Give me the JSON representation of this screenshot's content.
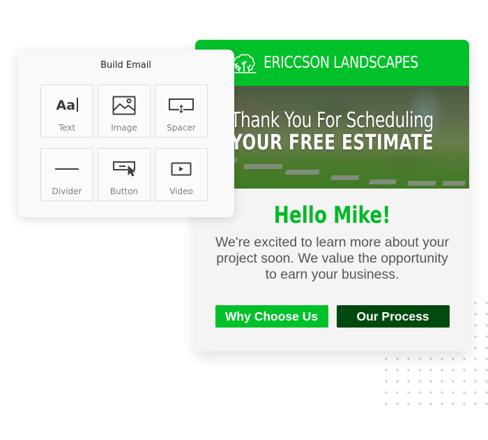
{
  "build_panel": {
    "title": "Build Email",
    "tiles": [
      {
        "label": "Text",
        "icon": "text-icon",
        "glyph": "Aa"
      },
      {
        "label": "Image",
        "icon": "image-icon"
      },
      {
        "label": "Spacer",
        "icon": "spacer-icon"
      },
      {
        "label": "Divider",
        "icon": "divider-icon"
      },
      {
        "label": "Button",
        "icon": "button-icon"
      },
      {
        "label": "Video",
        "icon": "video-icon"
      }
    ]
  },
  "email": {
    "brand": {
      "name": "ERICCSON LANDSCAPES",
      "logo": "tree-icon"
    },
    "hero": {
      "line1": "Thank You For Scheduling",
      "line2": "YOUR FREE ESTIMATE"
    },
    "greeting": "Hello Mike!",
    "body": "We're excited to learn more about your project soon. We value the opportunity to earn your business.",
    "buttons": [
      {
        "label": "Why Choose Us"
      },
      {
        "label": "Our Process"
      }
    ]
  },
  "colors": {
    "brand_green": "#00c12a",
    "dark_green": "#004a0e",
    "greeting_green": "#00b827",
    "card_bg": "#f4f4f4",
    "panel_bg": "#f9f9f9"
  }
}
